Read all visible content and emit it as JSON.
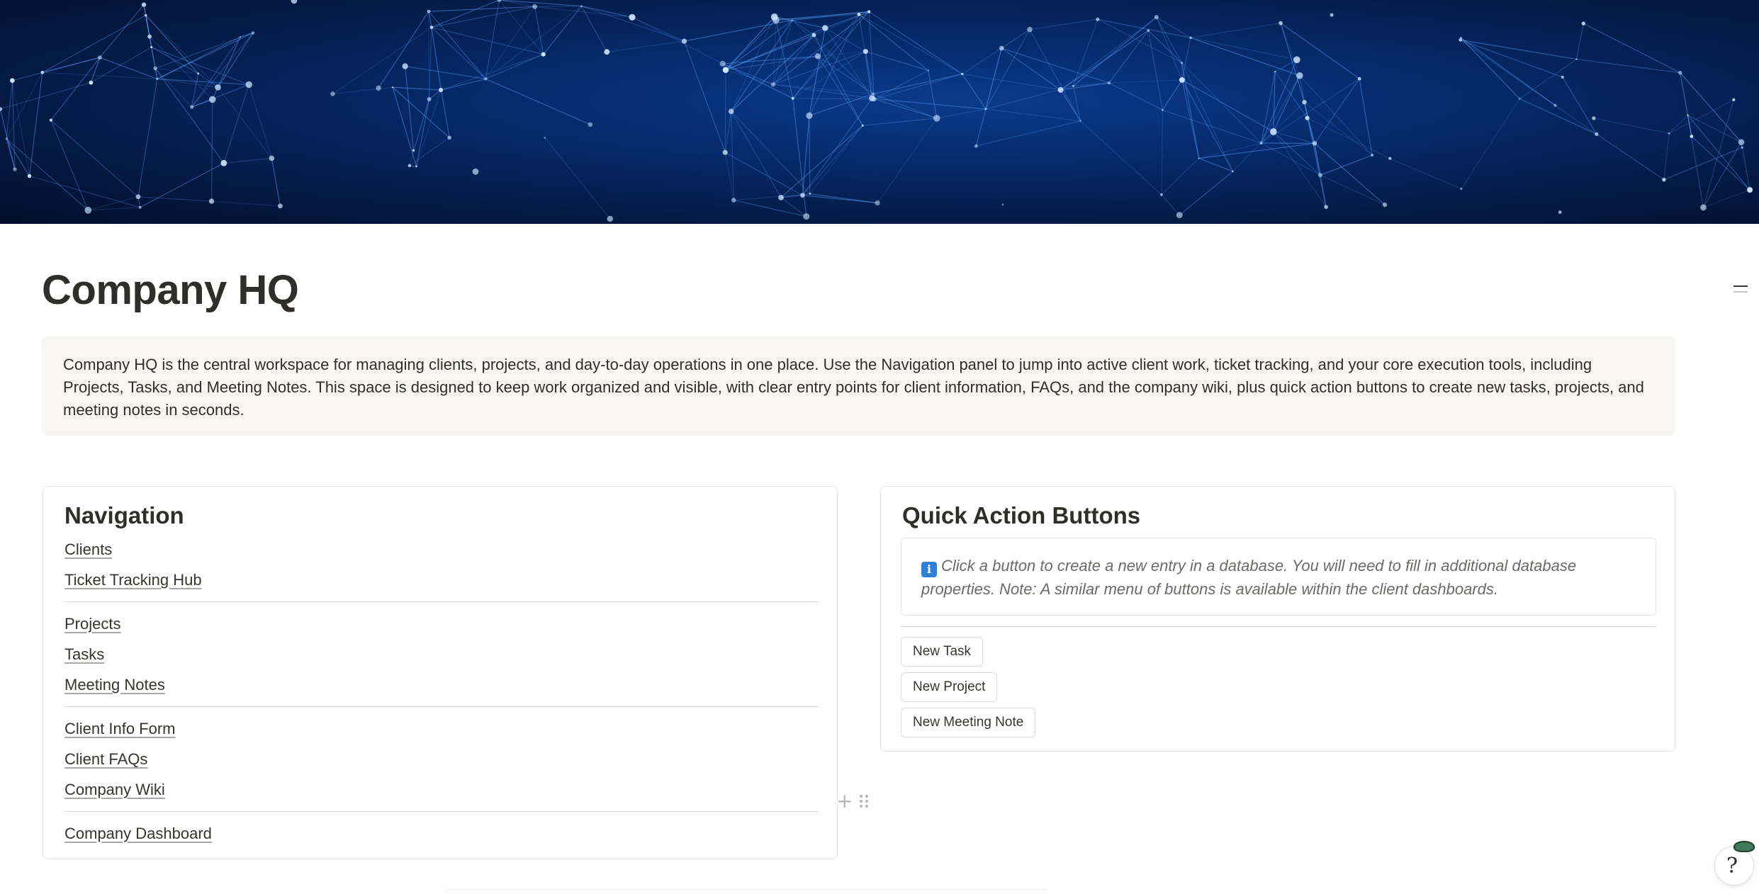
{
  "page": {
    "title": "Company HQ",
    "description": "Company HQ is the central workspace for managing clients, projects, and day-to-day operations in one place. Use the Navigation panel to jump into active client work, ticket tracking, and your core execution tools, including Projects, Tasks, and Meeting Notes. This space is designed to keep work organized and visible, with clear entry points for client information, FAQs, and the company wiki, plus quick action buttons to create new tasks, projects, and meeting notes in seconds."
  },
  "navigation": {
    "heading": "Navigation",
    "links": [
      "Clients",
      "Ticket Tracking Hub",
      "Projects",
      "Tasks",
      "Meeting Notes",
      "Client Info Form",
      "Client FAQs",
      "Company Wiki",
      "Company Dashboard"
    ]
  },
  "quick_actions": {
    "heading": "Quick Action Buttons",
    "info_icon": "info-icon",
    "info_text": "Click a button to create a new entry in a database. You will need to fill in additional database properties. Note: A similar menu of buttons is available within the client dashboards.",
    "buttons": [
      "New Task",
      "New Project",
      "New Meeting Note"
    ]
  },
  "icons": {
    "cover": "network-cover-image",
    "toc": "table-of-contents-icon",
    "add": "plus-icon",
    "drag": "drag-handle-icon",
    "help": "help-assistant-icon"
  },
  "colors": {
    "text": "#37352f",
    "callout_bg": "#f7f6f3",
    "border": "#e6e5e1",
    "info_icon": "#2e7fd8"
  }
}
